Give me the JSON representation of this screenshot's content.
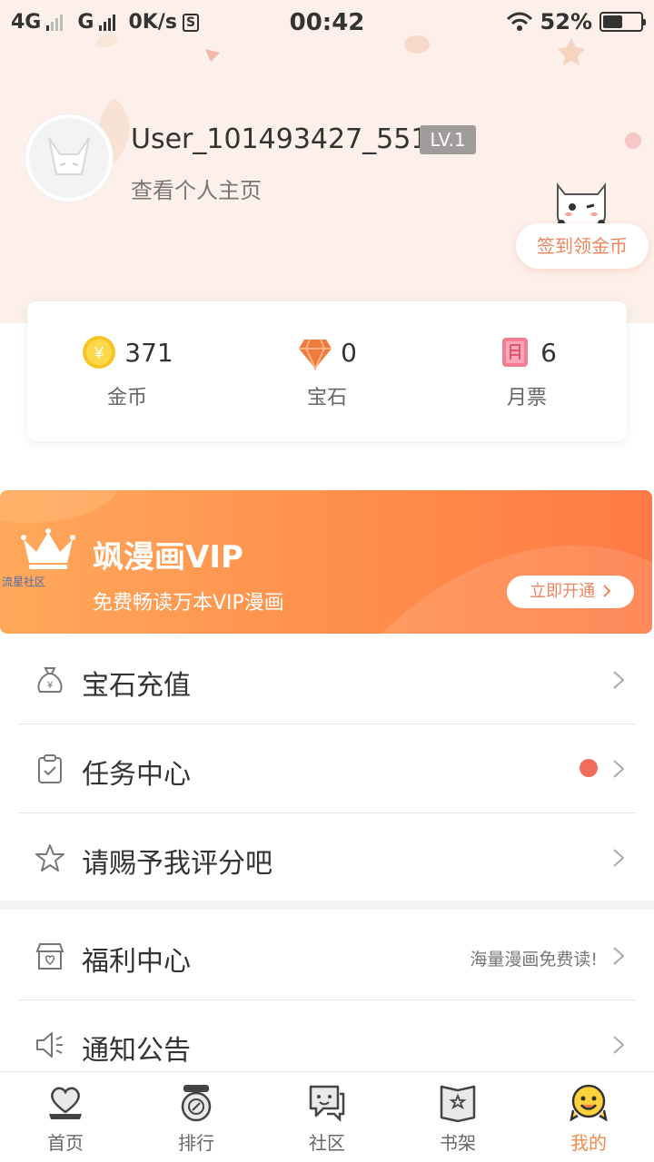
{
  "status_bar": {
    "network_1": "4G",
    "network_2": "G",
    "speed": "0K/s",
    "sim_badge": "S",
    "time": "00:42",
    "battery": "52%",
    "battery_level": 0.52
  },
  "profile": {
    "username": "User_101493427_551",
    "level": "LV.1",
    "view_profile": "查看个人主页",
    "checkin_label": "签到领金币"
  },
  "assets": [
    {
      "icon": "coin-icon",
      "value": "371",
      "label": "金币"
    },
    {
      "icon": "gem-icon",
      "value": "0",
      "label": "宝石"
    },
    {
      "icon": "monthly-ticket-icon",
      "value": "6",
      "label": "月票"
    }
  ],
  "vip": {
    "title": "飒漫画VIP",
    "subtitle": "免费畅读万本VIP漫画",
    "button": "立即开通",
    "watermark": "流星社区"
  },
  "menu": [
    {
      "icon": "money-bag-icon",
      "label": "宝石充值"
    },
    {
      "icon": "clipboard-check-icon",
      "label": "任务中心",
      "has_dot": true
    },
    {
      "icon": "star-outline-icon",
      "label": "请赐予我评分吧"
    },
    {
      "icon": "gift-shop-icon",
      "label": "福利中心",
      "hint": "海量漫画免费读!"
    },
    {
      "icon": "speaker-icon",
      "label": "通知公告"
    }
  ],
  "nav": [
    {
      "icon": "home-heart-icon",
      "label": "首页",
      "active": false
    },
    {
      "icon": "ranking-icon",
      "label": "排行",
      "active": false
    },
    {
      "icon": "community-chat-icon",
      "label": "社区",
      "active": false
    },
    {
      "icon": "bookshelf-icon",
      "label": "书架",
      "active": false
    },
    {
      "icon": "profile-face-icon",
      "label": "我的",
      "active": true
    }
  ],
  "colors": {
    "accent": "#f08a4a",
    "header_bg": "#fdf0eb",
    "vip_start": "#ffa85a",
    "vip_end": "#ff7a45",
    "badge_dot": "#f36b5a"
  }
}
